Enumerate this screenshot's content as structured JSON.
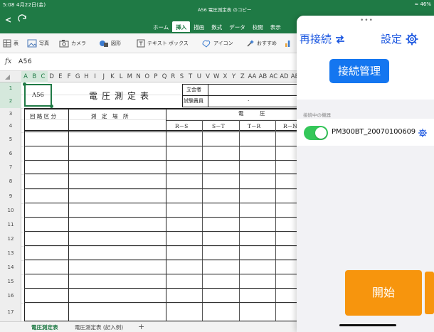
{
  "status": {
    "time": "5:08  4月22日(金)",
    "battery": "46%"
  },
  "window": {
    "doc_title": "A56 電圧測定表 のコピー",
    "tabs": [
      "ホーム",
      "挿入",
      "描画",
      "数式",
      "データ",
      "校閲",
      "表示"
    ],
    "active_tab": "挿入"
  },
  "toolbar": {
    "table_label": "表",
    "photo_label": "写真",
    "camera_label": "カメラ",
    "shapes_label": "図形",
    "textbox_label": "テキスト ボックス",
    "icons_label": "アイコン",
    "recommend_label": "おすすめ"
  },
  "formula_bar": {
    "fx": "fx",
    "cell_ref": "A56"
  },
  "grid": {
    "columns": [
      "A",
      "B",
      "C",
      "D",
      "E",
      "F",
      "G",
      "H",
      "I",
      "J",
      "K",
      "L",
      "M",
      "N",
      "O",
      "P",
      "Q",
      "R",
      "S",
      "T",
      "U",
      "V",
      "W",
      "X",
      "Y",
      "Z",
      "AA",
      "AB",
      "AC",
      "AD",
      "AE"
    ],
    "selected_columns": [
      "A",
      "B",
      "C"
    ],
    "rows": [
      "1",
      "2",
      "3",
      "4",
      "5",
      "6",
      "7",
      "8",
      "9",
      "10",
      "11",
      "12",
      "13",
      "14",
      "15",
      "16",
      "17"
    ],
    "selected_rows": [
      "1",
      "2"
    ]
  },
  "form": {
    "cell_value": "A56",
    "title": "電圧測定表",
    "witness_label": "立会者",
    "tester_label": "試験責員",
    "col_circuit": "回 路 区 分",
    "col_location": "測　定　場　所",
    "col_group_label": "電　　　圧",
    "col_rs": "R－S",
    "col_st": "S－T",
    "col_tr": "T－R",
    "col_rn": "R－N"
  },
  "sheet_tabs": {
    "tab1": "電圧測定表",
    "tab2": "電圧測定表 (記入例)",
    "add": "+"
  },
  "panel": {
    "grip": "•••",
    "reconnect_label": "再接続",
    "settings_label": "設定",
    "conn_mgmt_label": "接続管理",
    "list_caption": "接続中の機器",
    "device_name": "PM300BT_20070100609",
    "device_enabled": true,
    "start_label": "開始"
  },
  "colors": {
    "excel_green": "#1f7a45",
    "link_blue": "#1a56e0",
    "button_blue": "#1476f0",
    "start_orange": "#f7950d",
    "toggle_green": "#34c759"
  }
}
